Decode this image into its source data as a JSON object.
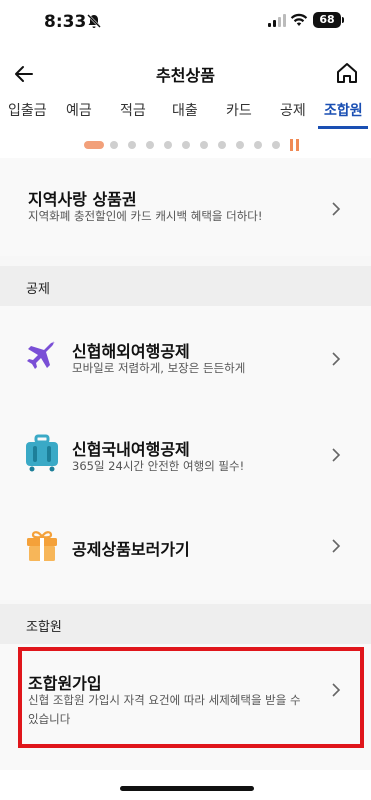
{
  "status_bar": {
    "time": "8:33",
    "battery": "68"
  },
  "header": {
    "title": "추천상품"
  },
  "tabs": [
    "입출금",
    "예금",
    "적금",
    "대출",
    "카드",
    "공제",
    "조합원"
  ],
  "active_tab": "조합원",
  "carousel": {
    "total_dots": 11,
    "active_index": 0
  },
  "promo": {
    "title": "지역사랑 상품권",
    "subtitle": "지역화폐 충전할인에 카드 캐시백 혜택을 더하다!"
  },
  "sections": {
    "gongje": {
      "label": "공제",
      "items": [
        {
          "title": "신협해외여행공제",
          "subtitle": "모바일로 저렴하게, 보장은 든든하게",
          "icon": "airplane-icon"
        },
        {
          "title": "신협국내여행공제",
          "subtitle": "365일 24시간 안전한 여행의 필수!",
          "icon": "suitcase-icon"
        },
        {
          "title": "공제상품보러가기",
          "subtitle": "",
          "icon": "gift-icon"
        }
      ]
    },
    "member": {
      "label": "조합원",
      "item": {
        "title": "조합원가입",
        "subtitle_line1": "신협 조합원 가입시 자격 요건에 따라 세제혜택을 받을 수",
        "subtitle_line2": "있습니다"
      }
    }
  },
  "colors": {
    "accent": "#1a4fb3",
    "highlight": "#e0161b",
    "carousel_active": "#f2a07a"
  }
}
